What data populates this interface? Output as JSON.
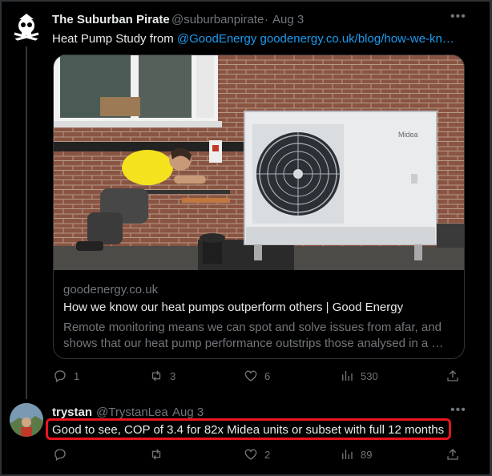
{
  "tweet1": {
    "display_name": "The Suburban Pirate",
    "handle": "@suburbanpirate",
    "separator": "·",
    "date": "Aug 3",
    "text_prefix": "Heat Pump Study from ",
    "mention": "@GoodEnergy",
    "url_text": "goodenergy.co.uk/blog/how-we-kn…",
    "card": {
      "domain": "goodenergy.co.uk",
      "title": "How we know our heat pumps outperform others | Good Energy",
      "description": "Remote monitoring means we can spot and solve issues from afar, and shows that our heat pump performance outstrips those analysed in a …",
      "unit_brand": "Midea"
    },
    "actions": {
      "replies": "1",
      "retweets": "3",
      "likes": "6",
      "views": "530"
    }
  },
  "tweet2": {
    "display_name": "trystan",
    "handle": "@TrystanLea",
    "separator": "·",
    "date": "Aug 3",
    "text": "Good to see, COP of 3.4 for 82x Midea units or subset with full 12 months",
    "actions": {
      "replies": "",
      "retweets": "",
      "likes": "2",
      "views": "89"
    }
  },
  "icons": {
    "more": "more-icon",
    "reply": "reply-icon",
    "retweet": "retweet-icon",
    "like": "heart-icon",
    "views": "views-icon",
    "share": "share-icon"
  },
  "colors": {
    "background": "#000000",
    "text": "#e7e9ea",
    "muted": "#71767b",
    "link": "#1d9bf0",
    "highlight": "#e8141e"
  }
}
